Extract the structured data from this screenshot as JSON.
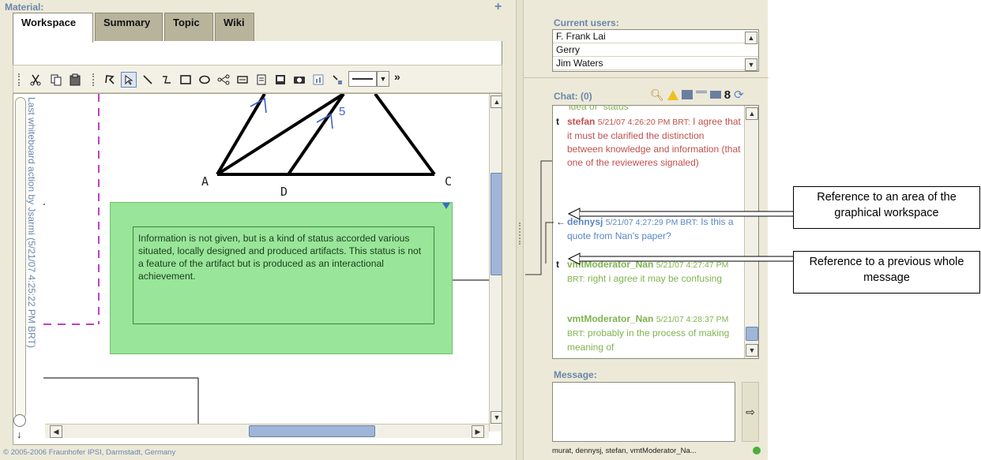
{
  "material": {
    "label": "Material:",
    "plus_icon": "+",
    "tabs": [
      {
        "label": "Workspace",
        "active": true
      },
      {
        "label": "Summary",
        "active": false
      },
      {
        "label": "Topic",
        "active": false
      },
      {
        "label": "Wiki",
        "active": false
      }
    ]
  },
  "toolbar": {
    "icons": [
      "cut-icon",
      "copy-icon",
      "paste-icon",
      "lasso-icon",
      "select-arrow-icon",
      "line-icon",
      "connector-icon",
      "rectangle-icon",
      "ellipse-icon",
      "graph-icon",
      "textbox-icon",
      "note-icon",
      "image-icon",
      "camera-icon",
      "chart-icon",
      "link-icon"
    ],
    "more": "»"
  },
  "whiteboard": {
    "vertical_caption": "Last whiteboard action by Jsarmi (5/21/07 4:25:22 PM BRT)",
    "point_labels": [
      "A",
      "D",
      "C"
    ],
    "edge_label": "5",
    "note_text": "Information is not given, but is a kind of status accorded various situated, locally designed and produced artifacts. This status is not a feature of the artifact but is produced as an interactional achievement."
  },
  "footer": "© 2005-2006 Fraunhofer IPSI, Darmstadt, Germany",
  "users": {
    "label": "Current users:",
    "list": [
      "F. Frank Lai",
      "Gerry",
      "Jim Waters"
    ]
  },
  "chat": {
    "label": "Chat: (0)",
    "partial_top": "idea of \"status\"",
    "messages": [
      {
        "marker": "t",
        "user": "stefan",
        "time": "5/21/07 4:26:20 PM BRT:",
        "text": "I agree that it must be clarified the distinction between knowledge and information (that one of the revieweres signaled)",
        "color": "#c0504d"
      },
      {
        "marker": "←",
        "user": "dennysj",
        "time": "5/21/07 4:27:29 PM BRT:",
        "text": "Is this a quote from Nan's paper?",
        "color": "#5a86c5"
      },
      {
        "marker": "t",
        "user": "vmtModerator_Nan",
        "time": "5/21/07 4:27:47 PM BRT:",
        "text": "right i agree it may be confusing",
        "color": "#7fb34f"
      },
      {
        "marker": "",
        "user": "vmtModerator_Nan",
        "time": "5/21/07 4:28:37 PM BRT:",
        "text": "probably in the process of making meaning of",
        "color": "#7fb34f"
      }
    ]
  },
  "message": {
    "label": "Message:",
    "status": "murat, dennysj, stefan, vmtModerator_Na..."
  },
  "callouts": {
    "area_reference": "Reference to an area of the graphical workspace",
    "message_reference": "Reference to a previous whole message"
  },
  "colors": {
    "accent_blue": "#6b86ad",
    "note_green": "#99e599",
    "stefan_red": "#c0504d",
    "dennysj_blue": "#5a86c5",
    "moderator_green": "#7fb34f"
  }
}
